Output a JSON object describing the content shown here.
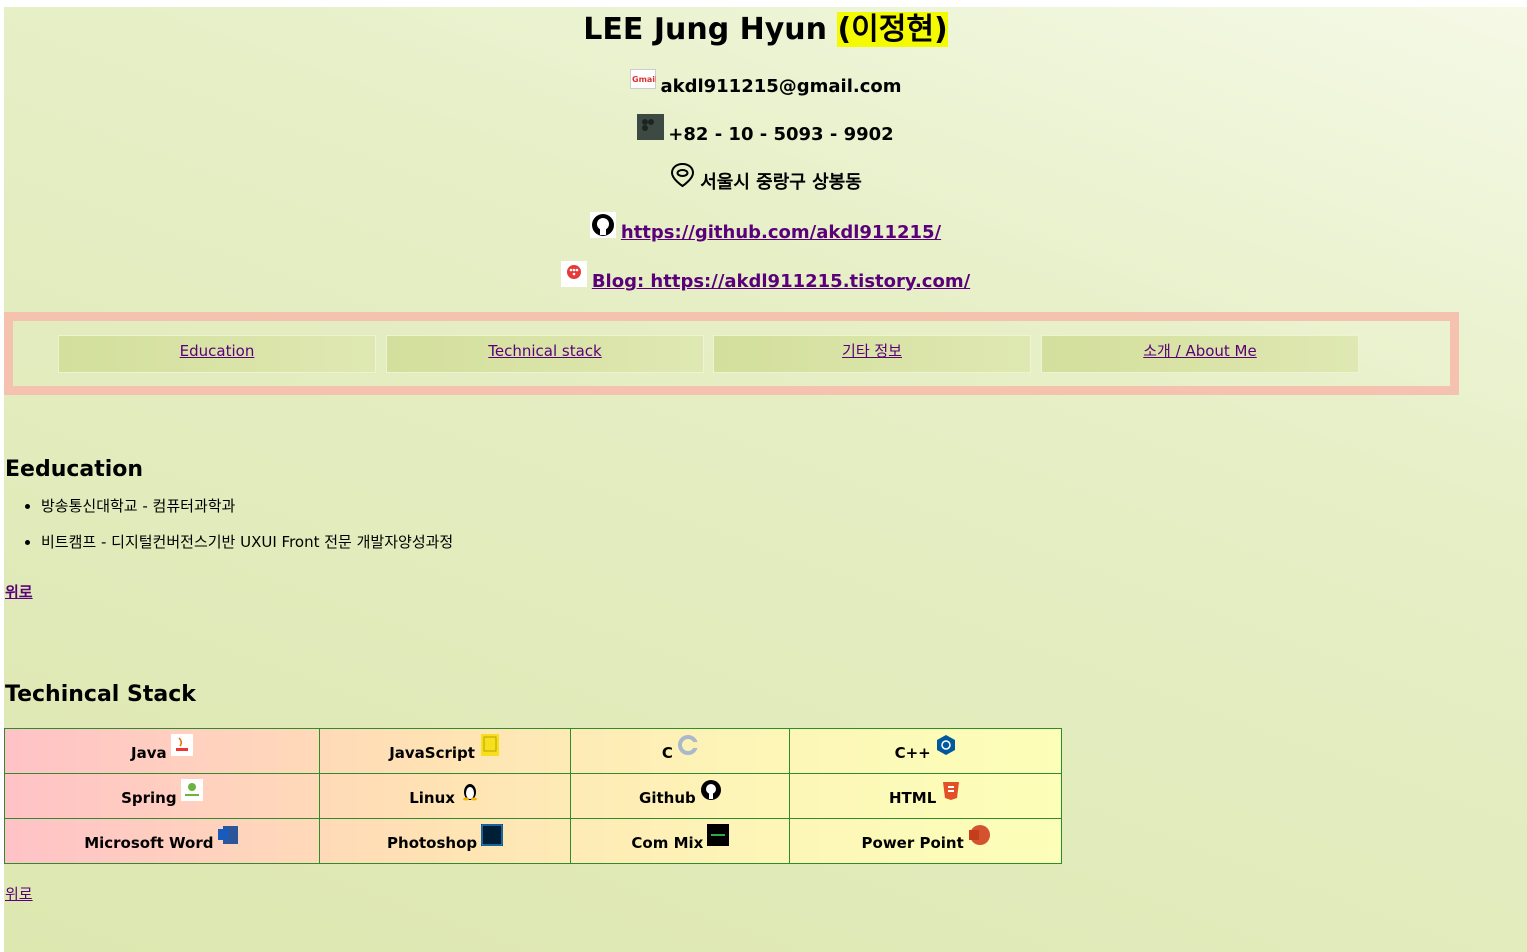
{
  "header": {
    "name": "LEE Jung Hyun",
    "name_korean": "(이정현)",
    "email": "akdl911215@gmail.com",
    "phone": "+82 - 10 - 5093 - 9902",
    "address": "서울시 중랑구 상봉동",
    "github_link": "https://github.com/akdl911215/",
    "blog_link": "Blog: https://akdl911215.tistory.com/",
    "gmail_icon_text": "Gmail"
  },
  "nav": {
    "items": [
      {
        "label": "Education"
      },
      {
        "label": "Technical stack"
      },
      {
        "label": "기타 정보"
      },
      {
        "label": "소개 / About Me"
      }
    ]
  },
  "education": {
    "heading": "Eeducation",
    "items": [
      "방송통신대학교 - 컴퓨터과학과",
      "비트캠프 - 디지털컨버전스기반 UXUI Front 전문 개발자양성과정"
    ],
    "up_link": "위로"
  },
  "stack": {
    "heading": "Techincal Stack",
    "rows": [
      [
        "Java",
        "JavaScript",
        "C",
        "C++"
      ],
      [
        "Spring",
        "Linux",
        "Github",
        "HTML"
      ],
      [
        "Microsoft Word",
        "Photoshop",
        "Com Mix",
        "Power Point"
      ]
    ],
    "up_link": "위로"
  },
  "colors": {
    "highlight": "#f4fb00",
    "nav_border": "#f6c2b0",
    "link": "#5a007a",
    "table_border": "#2e8b2e"
  }
}
